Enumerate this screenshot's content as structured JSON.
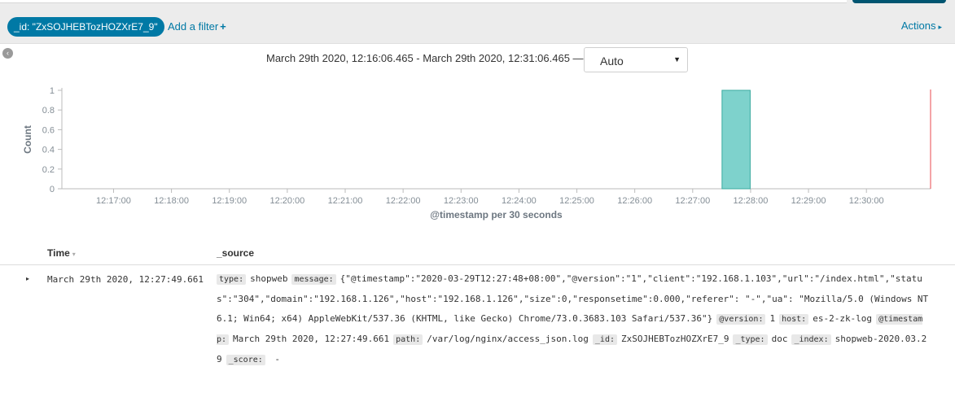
{
  "filter_bar": {
    "pill_label": "_id: \"ZxSOJHEBTozHOZXrE7_9\"",
    "add_filter_label": "Add a filter",
    "add_filter_plus": "+",
    "actions_label": "Actions",
    "actions_caret": "▸"
  },
  "collapse_icon_glyph": "‹",
  "time_range": {
    "text": "March 29th 2020, 12:16:06.465 - March 29th 2020, 12:31:06.465 —",
    "interval_value": "Auto",
    "interval_arrow": "▼"
  },
  "colors": {
    "accent": "#0079a5",
    "bar_fill": "#7ed2cc",
    "bar_stroke": "#3aab9f",
    "now_line": "#e8494f"
  },
  "chart_data": {
    "type": "bar",
    "title": "",
    "xlabel": "@timestamp per 30 seconds",
    "ylabel": "Count",
    "ylim": [
      0,
      1
    ],
    "yticks": [
      "0",
      "0.2",
      "0.4",
      "0.6",
      "0.8",
      "1"
    ],
    "xticks": [
      "12:17:00",
      "12:18:00",
      "12:19:00",
      "12:20:00",
      "12:21:00",
      "12:22:00",
      "12:23:00",
      "12:24:00",
      "12:25:00",
      "12:26:00",
      "12:27:00",
      "12:28:00",
      "12:29:00",
      "12:30:00"
    ],
    "x_range_start": "12:16:06.465",
    "x_range_end": "12:31:06.465",
    "bars": [
      {
        "start": "12:27:30",
        "end": "12:28:00",
        "value": 1
      }
    ],
    "grid": false,
    "legend": "none"
  },
  "table": {
    "columns": {
      "time": "Time",
      "time_sort": "▾",
      "source": "_source"
    },
    "rows": [
      {
        "expand": "▸",
        "time": "March 29th 2020, 12:27:49.661",
        "source": [
          {
            "k": "type:",
            "v": "shopweb"
          },
          {
            "k": "message:",
            "v": "{\"@timestamp\":\"2020-03-29T12:27:48+08:00\",\"@version\":\"1\",\"client\":\"192.168.1.103\",\"url\":\"/index.html\",\"status\":\"304\",\"domain\":\"192.168.1.126\",\"host\":\"192.168.1.126\",\"size\":0,\"responsetime\":0.000,\"referer\": \"-\",\"ua\": \"Mozilla/5.0 (Windows NT 6.1; Win64; x64) AppleWebKit/537.36 (KHTML, like Gecko) Chrome/73.0.3683.103 Safari/537.36\"}"
          },
          {
            "k": "@version:",
            "v": "1"
          },
          {
            "k": "host:",
            "v": "es-2-zk-log"
          },
          {
            "k": "@timestamp:",
            "v": "March 29th 2020, 12:27:49.661"
          },
          {
            "k": "path:",
            "v": "/var/log/nginx/access_json.log"
          },
          {
            "k": "_id:",
            "v": "ZxSOJHEBTozHOZXrE7_9"
          },
          {
            "k": "_type:",
            "v": "doc"
          },
          {
            "k": "_index:",
            "v": "shopweb-2020.03.29"
          },
          {
            "k": "_score:",
            "v": " -"
          }
        ]
      }
    ]
  }
}
